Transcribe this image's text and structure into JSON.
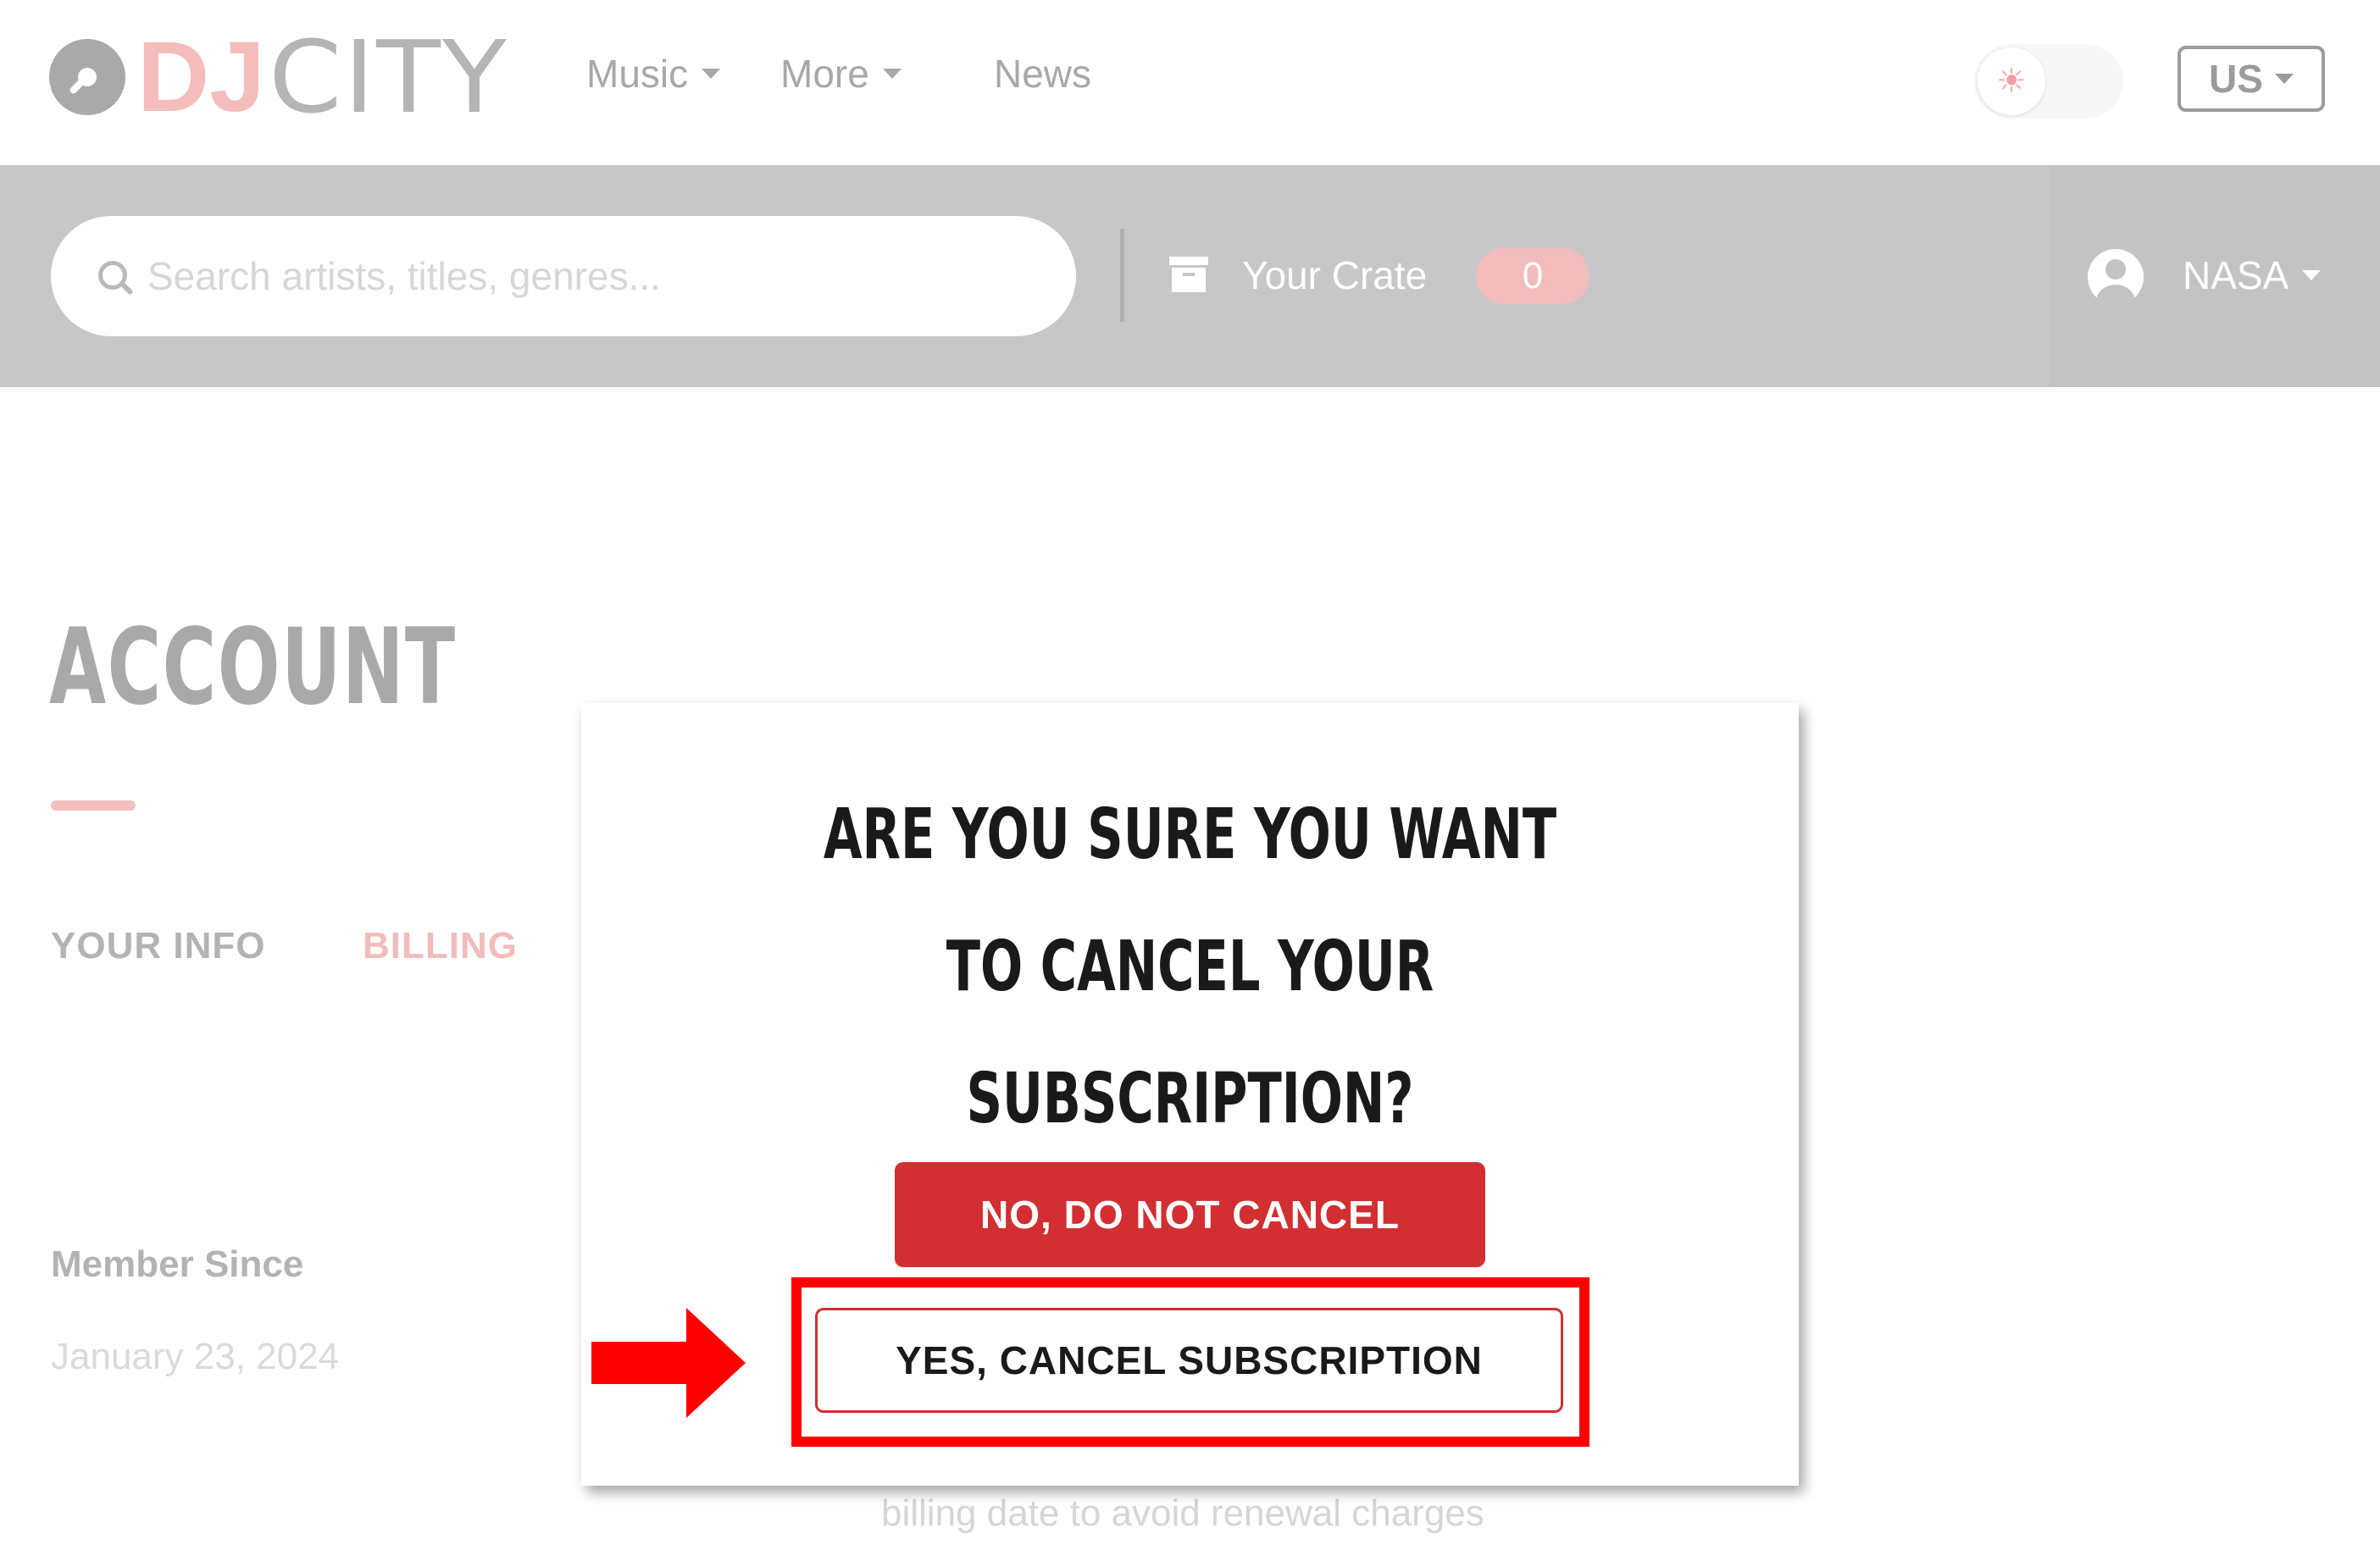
{
  "brand": {
    "dj": "DJ",
    "city": "CITY"
  },
  "nav": {
    "music": "Music",
    "more": "More",
    "news": "News",
    "region": "US"
  },
  "search": {
    "placeholder": "Search artists, titles, genres..."
  },
  "crate": {
    "label": "Your Crate",
    "count": "0"
  },
  "user": {
    "name": "NASA"
  },
  "account": {
    "title": "ACCOUNT",
    "tabs": {
      "info": "YOUR INFO",
      "billing": "BILLING"
    },
    "member_since_label": "Member Since",
    "member_since_value": "January 23, 2024",
    "behind_note": "billing date to avoid renewal charges"
  },
  "modal": {
    "title": "ARE YOU SURE YOU WANT TO CANCEL YOUR SUBSCRIPTION?",
    "no_button": "NO, DO NOT CANCEL",
    "yes_button": "YES, CANCEL SUBSCRIPTION"
  },
  "colors": {
    "accent_red": "#d12f32",
    "annotation_red": "#ff0000",
    "brand_pink": "#f5bcbc"
  },
  "icons": {
    "logo": "vinyl-disc-icon",
    "theme": "sun-icon",
    "search": "search-icon",
    "crate": "archive-box-icon",
    "user": "user-circle-icon"
  }
}
